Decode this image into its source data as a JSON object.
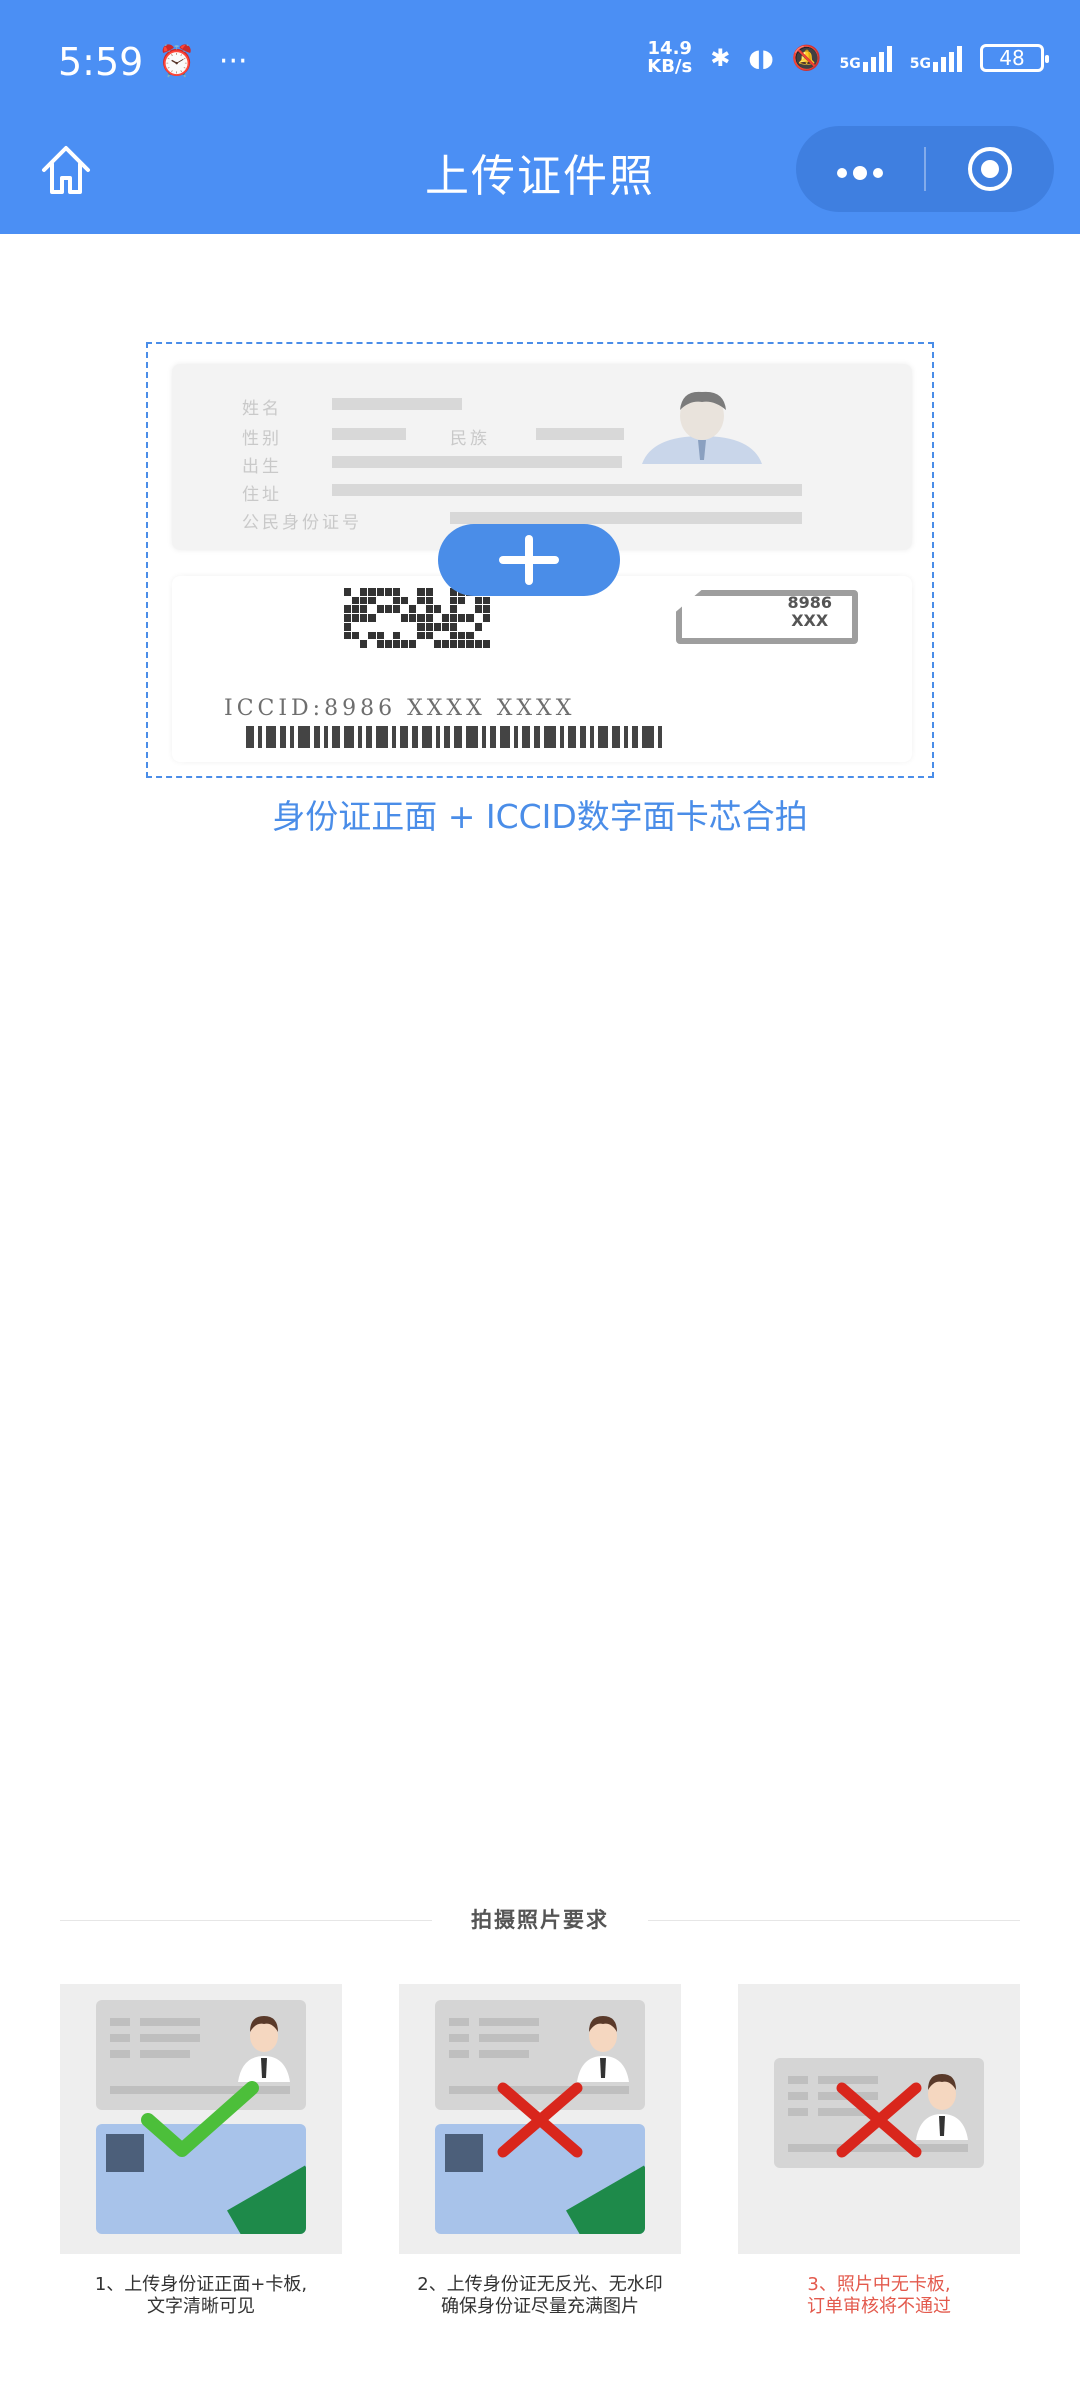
{
  "status_bar": {
    "time": "5:59",
    "more": "···",
    "net_speed_top": "14.9",
    "net_speed_bottom": "KB/s",
    "battery": "48",
    "sim1": "5G",
    "sim2": "5G"
  },
  "nav": {
    "title": "上传证件照",
    "home_icon": "home-icon",
    "more_icon": "more-dots-icon",
    "target_icon": "target-icon"
  },
  "upload": {
    "id_labels": [
      "姓名",
      "性别",
      "民族",
      "出生",
      "住址",
      "公民身份证号"
    ],
    "iccid_sample": "ICCID:8986 XXXX XXXX",
    "chip_label_top": "8986",
    "chip_label_bottom": "XXX",
    "caption": "身份证正面 + ICCID数字面卡芯合拍"
  },
  "requirements": {
    "title": "拍摄照片要求",
    "items": [
      {
        "line1": "1、上传身份证正面+卡板,",
        "line2": "文字清晰可见",
        "mark": "check"
      },
      {
        "line1": "2、上传身份证无反光、无水印",
        "line2": "确保身份证尽量充满图片",
        "mark": "cross"
      },
      {
        "line1": "3、照片中无卡板,",
        "line2": "订单审核将不通过",
        "mark": "cross"
      }
    ]
  },
  "colors": {
    "brand_blue": "#4b8ff4",
    "accent_blue": "#4a8de8",
    "warn_red": "#e35a4d",
    "check_green": "#4cbf3a",
    "cross_red": "#d9261c"
  }
}
